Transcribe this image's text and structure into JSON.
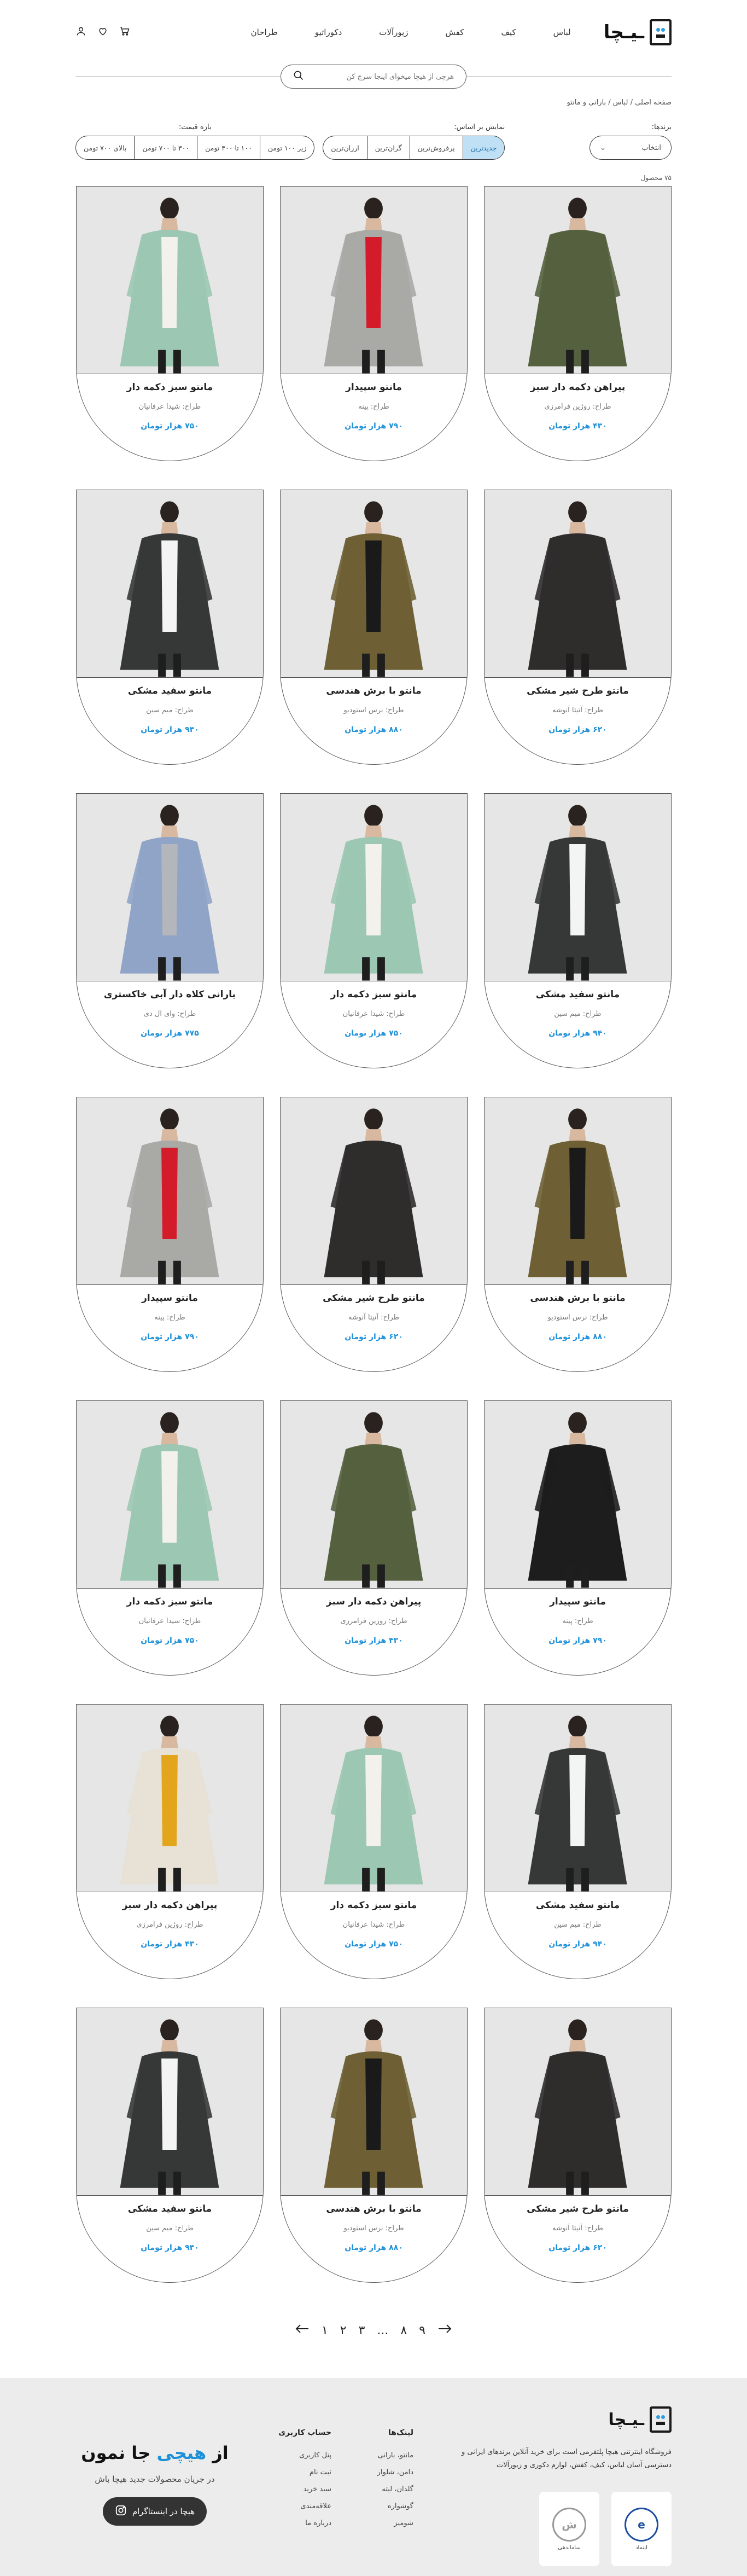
{
  "header": {
    "logo_text": "ـیـچا",
    "nav": [
      "لباس",
      "کیف",
      "کفش",
      "زیورآلات",
      "دکوراتیو",
      "طراحان"
    ],
    "icons": [
      "user-icon",
      "heart-icon",
      "cart-icon"
    ]
  },
  "search": {
    "placeholder": "هرچی از هیچا میخوای اینجا سرچ کن"
  },
  "breadcrumb": "صفحه اصلی / لباس / بارانی و مانتو",
  "filters": {
    "brand_label": "برندها:",
    "brand_value": "انتخاب",
    "sort_label": "نمایش بر اساس:",
    "sort_options": [
      "جدیدترین",
      "پرفروش‌ترین",
      "گران‌ترین",
      "ارزان‌ترین"
    ],
    "sort_active": 0,
    "price_label": "بازه قیمت:",
    "price_options": [
      "زیر ۱۰۰ تومن",
      "۱۰۰ تا ۳۰۰ تومن",
      "۳۰۰ تا ۷۰۰ تومن",
      "بالای ۷۰۰ تومن"
    ]
  },
  "count": "۷۵ محصول",
  "products": [
    {
      "title": "پیراهن دکمه دار سبز",
      "designer": "طراح: روژین فرامرزی",
      "price": "۴۳۰ هزار تومان",
      "color": "#55603f",
      "accent": "#55603f"
    },
    {
      "title": "مانتو سپیدار",
      "designer": "طراح: پینه",
      "price": "۷۹۰ هزار تومان",
      "color": "#a9a9a6",
      "accent": "#d31b2a"
    },
    {
      "title": "مانتو سبز دکمه دار",
      "designer": "طراح: شیدا عرفانیان",
      "price": "۷۵۰ هزار تومان",
      "color": "#9cc7b3",
      "accent": "#f2f1ec"
    },
    {
      "title": "مانتو طرح شیر مشکی",
      "designer": "طراح: آنیتا آنوشه",
      "price": "۶۲۰ هزار تومان",
      "color": "#2f2c2c",
      "accent": "#2f2c2c"
    },
    {
      "title": "مانتو با برش هندسی",
      "designer": "طراح: نرس استودیو",
      "price": "۸۸۰ هزار تومان",
      "color": "#6e6034",
      "accent": "#1a1a1a"
    },
    {
      "title": "مانتو سفید مشکی",
      "designer": "طراح: میم سین",
      "price": "۹۴۰ هزار تومان",
      "color": "#363838",
      "accent": "#f4f4f4"
    },
    {
      "title": "مانتو سفید مشکی",
      "designer": "طراح: میم سین",
      "price": "۹۴۰ هزار تومان",
      "color": "#363838",
      "accent": "#f4f4f4"
    },
    {
      "title": "مانتو سبز دکمه دار",
      "designer": "طراح: شیدا عرفانیان",
      "price": "۷۵۰ هزار تومان",
      "color": "#9cc7b3",
      "accent": "#f2f1ec"
    },
    {
      "title": "بارانی کلاه دار آبی خاکستری",
      "designer": "طراح: وای ال دی",
      "price": "۷۷۵ هزار تومان",
      "color": "#8fa4c6",
      "accent": "#b3b6bb"
    },
    {
      "title": "مانتو با برش هندسی",
      "designer": "طراح: نرس استودیو",
      "price": "۸۸۰ هزار تومان",
      "color": "#6e6034",
      "accent": "#1a1a1a"
    },
    {
      "title": "مانتو طرح شیر مشکی",
      "designer": "طراح: آنیتا آنوشه",
      "price": "۶۲۰ هزار تومان",
      "color": "#2f2c2c",
      "accent": "#2f2c2c"
    },
    {
      "title": "مانتو سپیدار",
      "designer": "طراح: پینه",
      "price": "۷۹۰ هزار تومان",
      "color": "#a9a9a6",
      "accent": "#d31b2a"
    },
    {
      "title": "مانتو سپیدار",
      "designer": "طراح: پینه",
      "price": "۷۹۰ هزار تومان",
      "color": "#1d1d1d",
      "accent": "#1d1d1d"
    },
    {
      "title": "پیراهن دکمه دار سبز",
      "designer": "طراح: روژین فرامرزی",
      "price": "۴۳۰ هزار تومان",
      "color": "#55603f",
      "accent": "#55603f"
    },
    {
      "title": "مانتو سبز دکمه دار",
      "designer": "طراح: شیدا عرفانیان",
      "price": "۷۵۰ هزار تومان",
      "color": "#9cc7b3",
      "accent": "#f2f1ec"
    },
    {
      "title": "مانتو سفید مشکی",
      "designer": "طراح: میم سین",
      "price": "۹۴۰ هزار تومان",
      "color": "#363838",
      "accent": "#f4f4f4"
    },
    {
      "title": "مانتو سبز دکمه دار",
      "designer": "طراح: شیدا عرفانیان",
      "price": "۷۵۰ هزار تومان",
      "color": "#9cc7b3",
      "accent": "#f2f1ec"
    },
    {
      "title": "پیراهن دکمه دار سبز",
      "designer": "طراح: روژین فرامرزی",
      "price": "۴۳۰ هزار تومان",
      "color": "#e7e1d6",
      "accent": "#e2a51c"
    },
    {
      "title": "مانتو طرح شیر مشکی",
      "designer": "طراح: آنیتا آنوشه",
      "price": "۶۲۰ هزار تومان",
      "color": "#2f2c2c",
      "accent": "#2f2c2c"
    },
    {
      "title": "مانتو با برش هندسی",
      "designer": "طراح: نرس استودیو",
      "price": "۸۸۰ هزار تومان",
      "color": "#6e6034",
      "accent": "#1a1a1a"
    },
    {
      "title": "مانتو سفید مشکی",
      "designer": "طراح: میم سین",
      "price": "۹۴۰ هزار تومان",
      "color": "#363838",
      "accent": "#f4f4f4"
    }
  ],
  "pagination": {
    "prev": "←",
    "pages": [
      "۱",
      "۲",
      "۳",
      "...",
      "۸",
      "۹"
    ],
    "next": "→"
  },
  "footer": {
    "logo_text": "ـیـچا",
    "about": "فروشگاه اینترنتی هیچا پلتفرمی است برای خرید آنلاین برندهای ایرانی و دسترسی آسان لباس، کیف، کفش، لوازم دکوری و زیورآلات",
    "badge_enamad": "اینماد",
    "badge_samandehi": "ساماندهی",
    "links_title": "لینک‌ها",
    "links": [
      "مانتو، بارانی",
      "دامن، شلوار",
      "گلدان، لیته",
      "گوشواره",
      "شومیز"
    ],
    "account_title": "حساب کاربری",
    "account": [
      "پنل کاربری",
      "ثبت نام",
      "سبد خرید",
      "علاقه‌مندی",
      "درباره ما"
    ],
    "insta_title_pre": "از",
    "insta_title_blue": "هیچی",
    "insta_title_post": "جا نمون",
    "insta_sub": "در جریان محصولات جدید هیچا باش",
    "insta_button": "هیچا در اینستاگرام"
  }
}
